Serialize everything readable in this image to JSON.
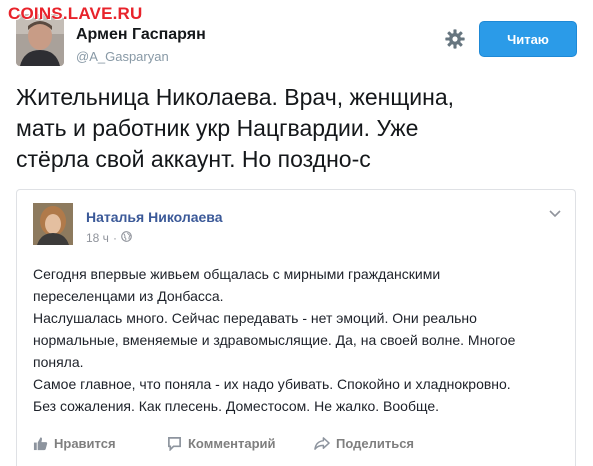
{
  "watermark": "COINS.LAVE.RU",
  "tweet": {
    "author_name": "Армен Гаспарян",
    "author_handle": "@A_Gasparyan",
    "follow_label": "Читаю",
    "lines": [
      "Жительница Николаева. Врач, женщина,",
      "мать и работник укр Нацгвардии. Уже",
      "стёрла свой аккаунт. Но поздно-с"
    ]
  },
  "fb_post": {
    "author_name": "Наталья Николаева",
    "time": "18 ч",
    "separator": "·",
    "lines": [
      "Сегодня впервые живьем общалась с мирными гражданскими",
      "переселенцами из Донбасса.",
      "Наслушалась много. Сейчас передавать - нет эмоций. Они реально",
      "нормальные, вменяемые и здравомыслящие. Да, на своей волне. Многое",
      "поняла.",
      "Самое главное, что поняла - их надо убивать. Спокойно и хладнокровно.",
      "Без сожаления. Как плесень. Доместосом. Не жалко. Вообще."
    ],
    "actions": {
      "like": "Нравится",
      "comment": "Комментарий",
      "share": "Поделиться"
    }
  },
  "icons": {
    "settings": "gear-icon",
    "post_menu": "chevron-down-icon",
    "audience": "globe-icon",
    "like": "thumbs-up-icon",
    "comment": "speech-bubble-icon",
    "share": "share-arrow-icon"
  },
  "colors": {
    "follow_button": "#2b9be8",
    "fb_name": "#3b5998",
    "watermark": "#e8232b"
  }
}
